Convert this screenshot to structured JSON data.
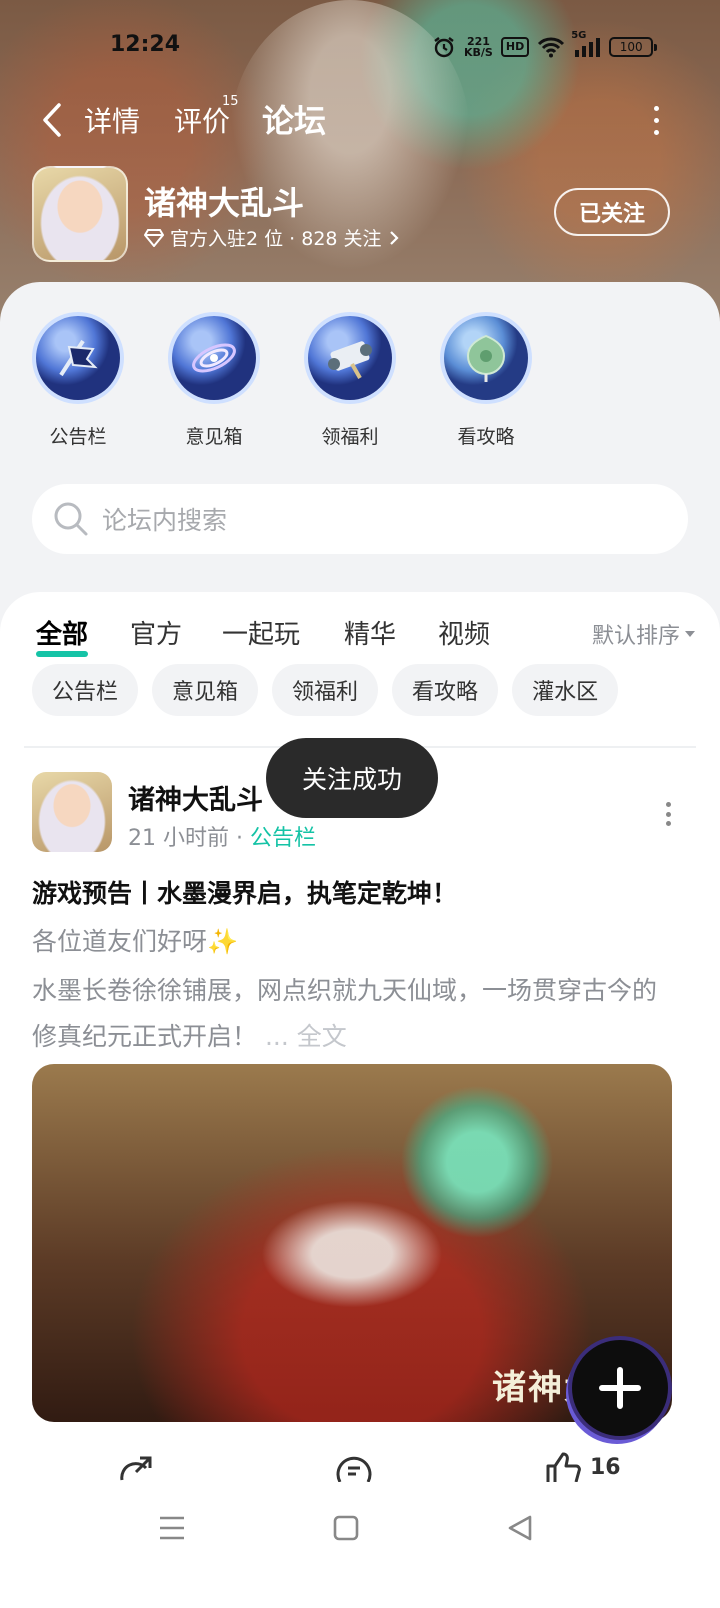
{
  "status_bar": {
    "time": "12:24",
    "net_speed_value": "221",
    "net_speed_unit": "KB/S",
    "hd_label": "HD",
    "signal_label": "5G",
    "battery": "100"
  },
  "nav": {
    "tabs": [
      {
        "label": "详情"
      },
      {
        "label": "评价",
        "badge": "15"
      },
      {
        "label": "论坛"
      }
    ]
  },
  "game": {
    "title": "诸神大乱斗",
    "meta": "官方入驻2 位 · 828 关注",
    "follow_label": "已关注"
  },
  "quick_links": [
    {
      "label": "公告栏",
      "icon": "banner-flag-icon"
    },
    {
      "label": "意见箱",
      "icon": "galaxy-icon"
    },
    {
      "label": "领福利",
      "icon": "scroll-icon"
    },
    {
      "label": "看攻略",
      "icon": "jade-pendant-icon"
    }
  ],
  "search": {
    "placeholder": "论坛内搜索"
  },
  "filter_tabs": [
    {
      "label": "全部"
    },
    {
      "label": "官方"
    },
    {
      "label": "一起玩"
    },
    {
      "label": "精华"
    },
    {
      "label": "视频"
    }
  ],
  "sort_label": "默认排序",
  "chips": [
    "公告栏",
    "意见箱",
    "领福利",
    "看攻略",
    "灌水区"
  ],
  "post": {
    "author": "诸神大乱斗",
    "time": "21 小时前",
    "separator": " · ",
    "tag": "公告栏",
    "title": "游戏预告丨水墨漫界启，执笔定乾坤！",
    "greeting": "各位道友们好呀✨",
    "body": "水墨长卷徐徐铺展，网点织就九天仙域，一场贯穿古今的修真纪元正式开启！",
    "more_label": "... 全文",
    "image_caption": "诸神大",
    "likes": "16"
  },
  "toast": "关注成功",
  "colors": {
    "accent": "#15c3a6",
    "muted_text": "#8c8f95",
    "toast_bg": "#2a2a2a"
  }
}
